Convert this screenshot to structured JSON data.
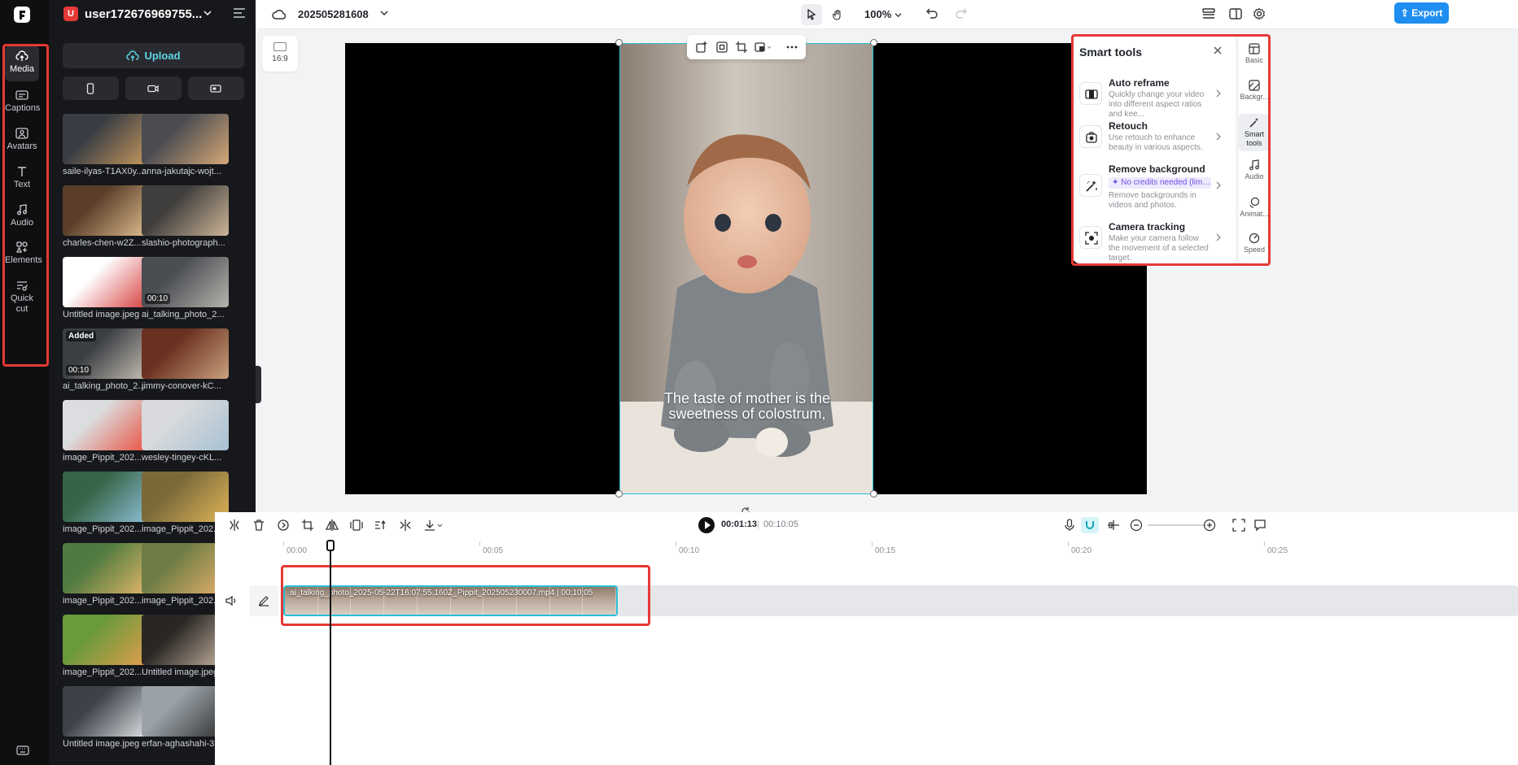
{
  "app": {
    "logo_letter": ""
  },
  "rail": {
    "items": [
      {
        "label": "Media",
        "icon": "cloud-upload-icon"
      },
      {
        "label": "Captions",
        "icon": "captions-icon"
      },
      {
        "label": "Avatars",
        "icon": "avatar-icon"
      },
      {
        "label": "Text",
        "icon": "text-icon"
      },
      {
        "label": "Audio",
        "icon": "music-note-icon"
      },
      {
        "label": "Elements",
        "icon": "elements-icon"
      },
      {
        "label": "Quick",
        "label2": "cut",
        "icon": "scissors-icon"
      }
    ]
  },
  "panel": {
    "user_badge": "U",
    "user_name": "user172676969755...",
    "upload_label": "Upload",
    "media": [
      {
        "label": "saile-ilyas-T1AX0y..."
      },
      {
        "label": "anna-jakutajc-wojt..."
      },
      {
        "label": "charles-chen-w2Z..."
      },
      {
        "label": "slashio-photograph..."
      },
      {
        "label": "Untitled image.jpeg"
      },
      {
        "label": "ai_talking_photo_2...",
        "duration": "00:10"
      },
      {
        "label": "ai_talking_photo_2...",
        "duration": "00:10",
        "badge": "Added"
      },
      {
        "label": "jimmy-conover-kC..."
      },
      {
        "label": "image_Pippit_202..."
      },
      {
        "label": "wesley-tingey-cKL..."
      },
      {
        "label": "image_Pippit_202..."
      },
      {
        "label": "image_Pippit_202..."
      },
      {
        "label": "image_Pippit_202..."
      },
      {
        "label": "image_Pippit_202..."
      },
      {
        "label": "image_Pippit_202..."
      },
      {
        "label": "Untitled image.jpeg"
      },
      {
        "label": "Untitled image.jpeg"
      },
      {
        "label": "erfan-aghashahi-3..."
      }
    ]
  },
  "topbar": {
    "project_title": "202505281608",
    "zoom": "100%",
    "export_label": "Export"
  },
  "stage": {
    "ratio_label": "16:9",
    "caption_line1": "The taste of mother is the",
    "caption_line2": "sweetness of colostrum,"
  },
  "smart_tools": {
    "title": "Smart tools",
    "items": [
      {
        "name": "Auto reframe",
        "desc": "Quickly change your video into different aspect ratios and kee..."
      },
      {
        "name": "Retouch",
        "desc": "Use retouch to enhance beauty in various aspects."
      },
      {
        "name": "Remove background",
        "badge": "✦ No credits needed (limit...",
        "desc": "Remove backgrounds in videos and photos."
      },
      {
        "name": "Camera tracking",
        "desc": "Make your camera follow the movement of a selected target."
      }
    ]
  },
  "side_tabs": [
    {
      "label": "Basic"
    },
    {
      "label": "Backgr..."
    },
    {
      "label": "Smart",
      "label2": "tools"
    },
    {
      "label": "Audio"
    },
    {
      "label": "Animat..."
    },
    {
      "label": "Speed"
    }
  ],
  "timeline": {
    "current_time": "00:01:13",
    "separator": "|",
    "total_time": "00:10:05",
    "ruler": [
      "00:00",
      "00:05",
      "00:10",
      "00:15",
      "00:20",
      "00:25"
    ],
    "clip_label": "ai_talking_photo_2025-05-22T16:07:55.160Z_Pippit_202505230007.mp4",
    "clip_duration": "00:10:05"
  },
  "colors": {
    "accent": "#1f8ef1",
    "selection": "#28c1d7",
    "highlight_box": "#e53935"
  }
}
